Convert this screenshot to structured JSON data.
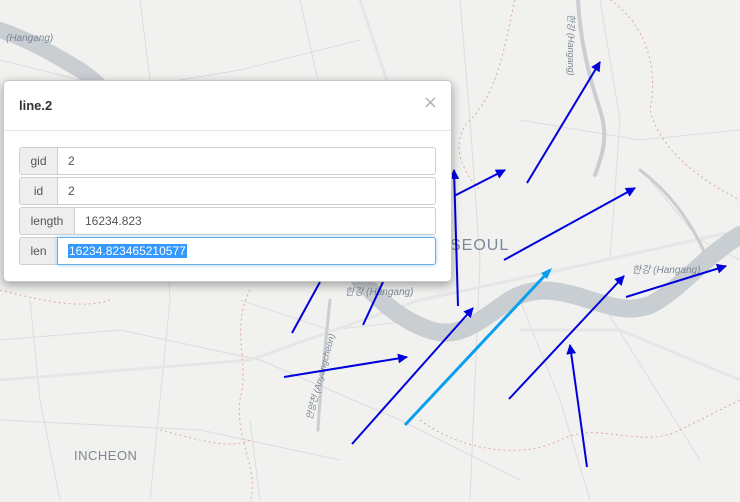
{
  "map": {
    "labels": {
      "hangang_nw": "(Hangang)",
      "hangang_vertical": "한강 (Hangang)",
      "seoul": "SEOUL",
      "hangang_center": "한강 (Hangang)",
      "anyangcheon": "안양천 (Anyangcheon)",
      "hangang_east": "한강 (Hangang)",
      "incheon": "INCHEON"
    },
    "colors": {
      "background": "#f1f1ef",
      "water": "#c9ced2",
      "arrow": "#0000dd",
      "highlight_line": "#0aa0f0"
    }
  },
  "popup": {
    "title": "line.2",
    "close_icon": "×",
    "fields": [
      {
        "key": "gid",
        "value": "2"
      },
      {
        "key": "id",
        "value": "2"
      },
      {
        "key": "length",
        "value": "16234.823"
      },
      {
        "key": "len",
        "value": "16234.823465210577"
      }
    ]
  }
}
